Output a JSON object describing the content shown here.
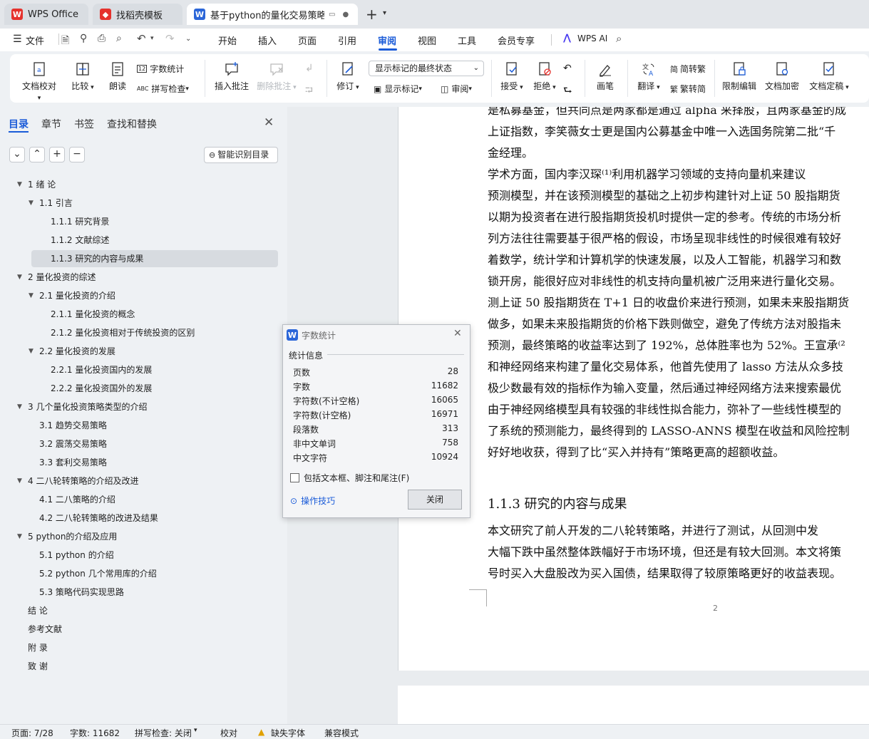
{
  "tabs": [
    {
      "label": "WPS Office",
      "icon": "wps-logo-icon",
      "color": "#e5322d"
    },
    {
      "label": "找稻壳模板",
      "icon": "docer-icon",
      "color": "#e5322d"
    },
    {
      "label": "基于python的量化交易策略",
      "icon": "word-doc-icon",
      "color": "#2b66d8"
    }
  ],
  "new_tab_symbol": "+",
  "menu": {
    "file": "文件",
    "items": [
      "开始",
      "插入",
      "页面",
      "引用",
      "审阅",
      "视图",
      "工具",
      "会员专享"
    ],
    "active": "审阅",
    "wps_ai": "WPS AI"
  },
  "ribbon": {
    "doc_check": "文档校对",
    "compare": "比较",
    "read_aloud": "朗读",
    "word_count": "字数统计",
    "spell_check": "拼写检查",
    "insert_comment": "插入批注",
    "delete_comment": "删除批注",
    "revise": "修订",
    "markup_state": "显示标记的最终状态",
    "show_markup": "显示标记",
    "review": "审阅",
    "accept": "接受",
    "reject": "拒绝",
    "pen": "画笔",
    "translate": "翻译",
    "to_traditional": "简转繁",
    "to_simplified": "繁转简",
    "restrict_edit": "限制编辑",
    "encrypt": "文档加密",
    "finalize": "文档定稿"
  },
  "nav": {
    "tabs": [
      "目录",
      "章节",
      "书签",
      "查找和替换"
    ],
    "smart_toc": "智能识别目录",
    "toc": [
      {
        "label": "1  绪  论",
        "level": 1,
        "expand": true
      },
      {
        "label": "1.1  引言",
        "level": 2,
        "expand": true
      },
      {
        "label": "1.1.1  研究背景",
        "level": 3
      },
      {
        "label": "1.1.2  文献综述",
        "level": 3
      },
      {
        "label": "1.1.3  研究的内容与成果",
        "level": 3,
        "selected": true
      },
      {
        "label": "2  量化投资的综述",
        "level": 1,
        "expand": true
      },
      {
        "label": "2.1  量化投资的介绍",
        "level": 2,
        "expand": true
      },
      {
        "label": "2.1.1  量化投资的概念",
        "level": 3
      },
      {
        "label": "2.1.2  量化投资相对于传统投资的区别",
        "level": 3
      },
      {
        "label": "2.2  量化投资的发展",
        "level": 2,
        "expand": true
      },
      {
        "label": "2.2.1  量化投资国内的发展",
        "level": 3
      },
      {
        "label": "2.2.2  量化投资国外的发展",
        "level": 3
      },
      {
        "label": "3  几个量化投资策略类型的介绍",
        "level": 1,
        "expand": true
      },
      {
        "label": "3.1  趋势交易策略",
        "level": 2
      },
      {
        "label": "3.2  震荡交易策略",
        "level": 2
      },
      {
        "label": "3.3  套利交易策略",
        "level": 2
      },
      {
        "label": "4  二八轮转策略的介绍及改进",
        "level": 1,
        "expand": true
      },
      {
        "label": "4.1  二八策略的介绍",
        "level": 2
      },
      {
        "label": "4.2  二八轮转策略的改进及结果",
        "level": 2
      },
      {
        "label": "5 python的介绍及应用",
        "level": 1,
        "expand": true
      },
      {
        "label": "5.1 python 的介绍",
        "level": 2
      },
      {
        "label": "5.2 python 几个常用库的介绍",
        "level": 2
      },
      {
        "label": "5.3  策略代码实现思路",
        "level": 2
      },
      {
        "label": "结  论",
        "level": 0
      },
      {
        "label": "参考文献",
        "level": 0
      },
      {
        "label": "附  录",
        "level": 0
      },
      {
        "label": "致  谢",
        "level": 0
      }
    ]
  },
  "document": {
    "lines": [
      "是私募基金，但共同点是两家都是通过 alpha 来择股，且两家基金的成",
      "上证指数，李笑薇女士更是国内公募基金中唯一入选国务院第二批“千",
      "金经理。",
      "    学术方面，国内李汉琛⁽¹⁾利用机器学习领域的支持向量机来建议",
      "预测模型，并在该预测模型的基础之上初步构建针对上证 50 股指期货",
      "以期为投资者在进行股指期货投机时提供一定的参考。传统的市场分析",
      "列方法往往需要基于很严格的假设，市场呈现非线性的时候很难有较好",
      "着数学，统计学和计算机学的快速发展，以及人工智能，机器学习和数",
      "锁开房，能很好应对非线性的机支持向量机被广泛用来进行量化交易。",
      "测上证 50 股指期货在 T+1 日的收盘价来进行预测，如果未来股指期货",
      "做多，如果未来股指期货的价格下跌则做空，避免了传统方法对股指未",
      "预测，最终策略的收益率达到了 192%，总体胜率也为 52%。王宣承⁽²",
      "和神经网络来构建了量化交易体系，他首先使用了 lasso 方法从众多技",
      "极少数最有效的指标作为输入变量，然后通过神经网络方法来搜索最优",
      "由于神经网络模型具有较强的非线性拟合能力，弥补了一些线性模型的",
      "了系统的预测能力，最终得到的 LASSO-ANNS 模型在收益和风险控制",
      "好好地收获，得到了比“买入并持有”策略更高的超额收益。"
    ],
    "heading": "1.1.3  研究的内容与成果",
    "lines2": [
      "    本文研究了前人开发的二八轮转策略，并进行了测试，从回测中发",
      "大幅下跌中虽然整体跌幅好于市场环境，但还是有较大回测。本文将策",
      "号时买入大盘股改为买入国债，结果取得了较原策略更好的收益表现。"
    ],
    "page_number": "2"
  },
  "dialog": {
    "title": "字数统计",
    "section": "统计信息",
    "stats": [
      {
        "label": "页数",
        "value": "28"
      },
      {
        "label": "字数",
        "value": "11682"
      },
      {
        "label": "字符数(不计空格)",
        "value": "16065"
      },
      {
        "label": "字符数(计空格)",
        "value": "16971"
      },
      {
        "label": "段落数",
        "value": "313"
      },
      {
        "label": "非中文单词",
        "value": "758"
      },
      {
        "label": "中文字符",
        "value": "10924"
      }
    ],
    "include_checkbox": "包括文本框、脚注和尾注(F)",
    "tips": "操作技巧",
    "close": "关闭"
  },
  "status": {
    "page": "页面: 7/28",
    "words": "字数: 11682",
    "spell": "拼写检查: 关闭",
    "proof": "校对",
    "missing_font": "缺失字体",
    "compat": "兼容模式"
  },
  "colors": {
    "accent": "#1a5bd8",
    "wps_red": "#e5322d"
  }
}
